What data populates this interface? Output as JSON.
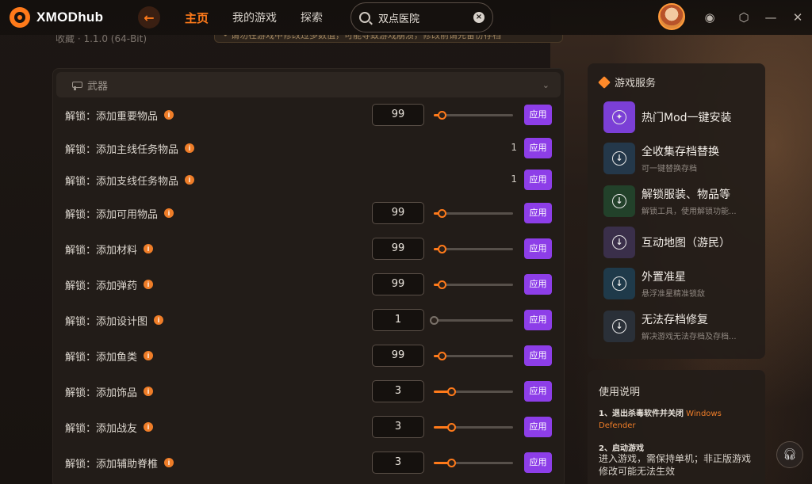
{
  "app": {
    "name": "XMODhub"
  },
  "topbar": {
    "nav": [
      {
        "label": "主页",
        "active": true
      },
      {
        "label": "我的游戏",
        "active": false
      },
      {
        "label": "探索",
        "active": false
      }
    ],
    "search": {
      "value": "双点医院"
    }
  },
  "subbar": {
    "meta": "收藏  ·  1.1.0 (64-Bit)",
    "notice": "• 请勿在游戏中修改过多数值，可能导致游戏崩溃，修改前请先备份存档"
  },
  "section": {
    "title": "武器"
  },
  "rows": [
    {
      "label": "解锁：添加重要物品",
      "value": "99",
      "level": 0.1,
      "apply": "应用"
    },
    {
      "label": "解锁：添加主线任务物品",
      "static": "1",
      "apply": "应用"
    },
    {
      "label": "解锁：添加支线任务物品",
      "static": "1",
      "apply": "应用"
    },
    {
      "label": "解锁：添加可用物品",
      "value": "99",
      "level": 0.1,
      "apply": "应用"
    },
    {
      "label": "解锁：添加材料",
      "value": "99",
      "level": 0.1,
      "apply": "应用"
    },
    {
      "label": "解锁：添加弹药",
      "value": "99",
      "level": 0.1,
      "apply": "应用"
    },
    {
      "label": "解锁：添加设计图",
      "value": "1",
      "level": 0,
      "apply": "应用"
    },
    {
      "label": "解锁：添加鱼类",
      "value": "99",
      "level": 0.1,
      "apply": "应用"
    },
    {
      "label": "解锁：添加饰品",
      "value": "3",
      "level": 0.22,
      "apply": "应用"
    },
    {
      "label": "解锁：添加战友",
      "value": "3",
      "level": 0.22,
      "apply": "应用"
    },
    {
      "label": "解锁：添加辅助脊椎",
      "value": "3",
      "level": 0.22,
      "apply": "应用"
    }
  ],
  "services": {
    "title": "游戏服务",
    "items": [
      {
        "name": "热门Mod一键安装",
        "sub": "",
        "color": "#7b3fd6"
      },
      {
        "name": "全收集存档替换",
        "sub": "可一键替换存档",
        "color": "#24384a"
      },
      {
        "name": "解锁服装、物品等",
        "sub": "解锁工具，使用解锁功能...",
        "color": "#22412a"
      },
      {
        "name": "互动地图（游民）",
        "sub": "",
        "color": "#3a2f4a"
      },
      {
        "name": "外置准星",
        "sub": "悬浮准星精准锁敌",
        "color": "#1f3a4a"
      },
      {
        "name": "无法存档修复",
        "sub": "解决游戏无法存档及存档...",
        "color": "#2a3038"
      }
    ]
  },
  "usage": {
    "title": "使用说明",
    "step1": "1、退出杀毒软件并关闭",
    "step1_hl": "Windows Defender",
    "step2": "2、启动游戏",
    "step2_text": "进入游戏，需保持单机；非正版游戏修改可能无法生效"
  },
  "colors": {
    "accent": "#ff7a1a",
    "apply": "#8d3ee8"
  }
}
